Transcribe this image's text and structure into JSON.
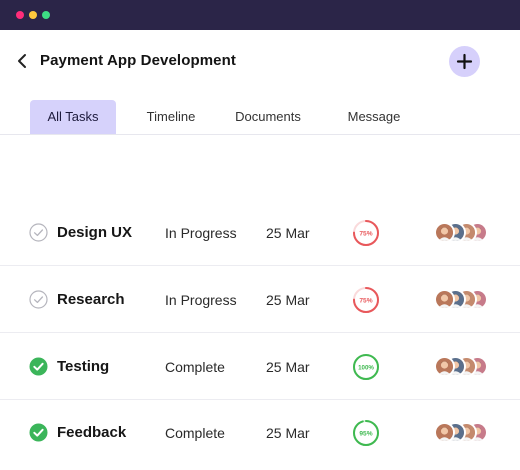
{
  "window": {
    "dot_colors": [
      "#ff2d7a",
      "#ffc83d",
      "#3ddc84"
    ]
  },
  "header": {
    "title": "Payment App Development",
    "back_icon": "chevron-left-icon",
    "add_icon": "plus-icon"
  },
  "tabs": [
    {
      "label": "All Tasks",
      "active": true
    },
    {
      "label": "Timeline",
      "active": false
    },
    {
      "label": "Documents",
      "active": false
    },
    {
      "label": "Message",
      "active": false
    }
  ],
  "tasks": [
    {
      "name": "Design UX",
      "status": "In Progress",
      "done": false,
      "date": "25 Mar",
      "progress_label": "75%",
      "progress": 0.75,
      "color": "#e8585b"
    },
    {
      "name": "Research",
      "status": "In Progress",
      "done": false,
      "date": "25 Mar",
      "progress_label": "75%",
      "progress": 0.75,
      "color": "#e8585b"
    },
    {
      "name": "Testing",
      "status": "Complete",
      "done": true,
      "date": "25 Mar",
      "progress_label": "100%",
      "progress": 1.0,
      "color": "#3fb950"
    },
    {
      "name": "Feedback",
      "status": "Complete",
      "done": true,
      "date": "25 Mar",
      "progress_label": "95%",
      "progress": 0.95,
      "color": "#3fb950"
    }
  ],
  "avatar_colors": [
    "#b9775a",
    "#5a6f8c",
    "#c48a6d",
    "#c77b8a"
  ]
}
